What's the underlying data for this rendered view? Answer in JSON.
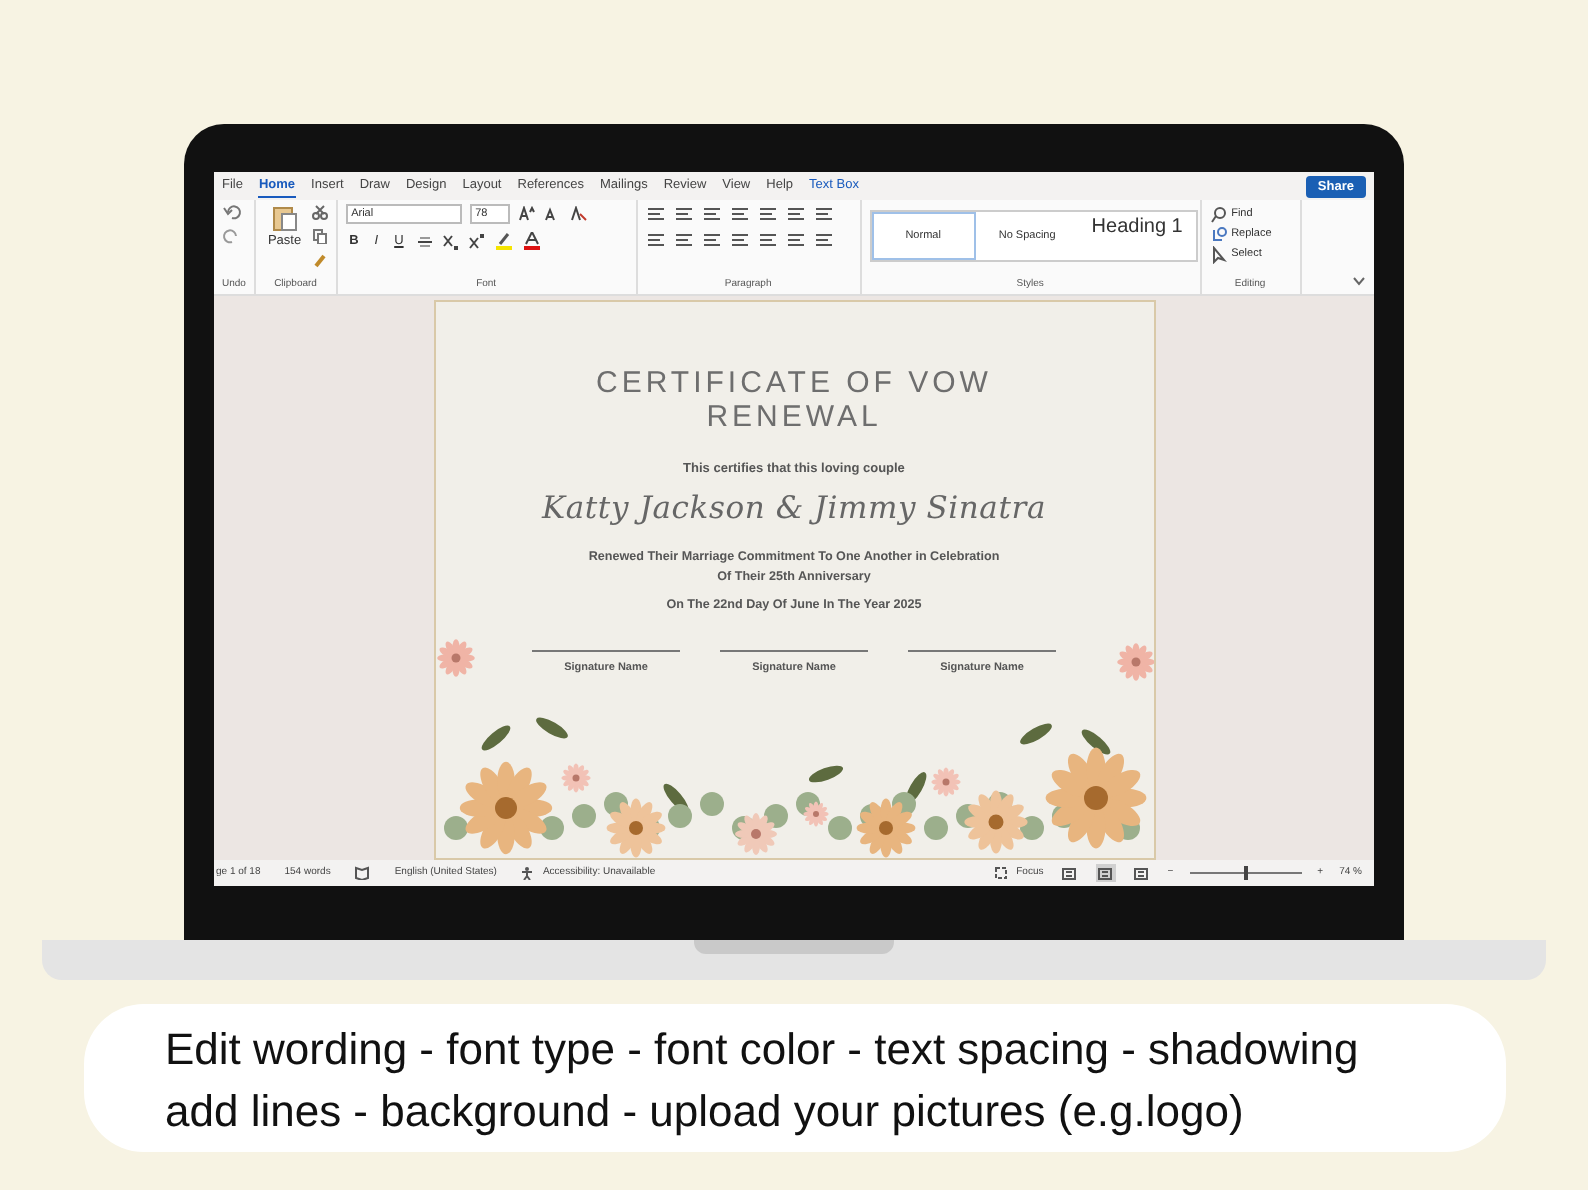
{
  "ribbon_tabs": [
    {
      "label": "File",
      "selected": false
    },
    {
      "label": "Home",
      "selected": true
    },
    {
      "label": "Insert",
      "selected": false
    },
    {
      "label": "Draw",
      "selected": false
    },
    {
      "label": "Design",
      "selected": false
    },
    {
      "label": "Layout",
      "selected": false
    },
    {
      "label": "References",
      "selected": false
    },
    {
      "label": "Mailings",
      "selected": false
    },
    {
      "label": "Review",
      "selected": false
    },
    {
      "label": "View",
      "selected": false
    },
    {
      "label": "Help",
      "selected": false
    },
    {
      "label": "Text Box",
      "selected": false
    }
  ],
  "share_button": "Share",
  "clipboard": {
    "paste": "Paste",
    "label": "Clipboard"
  },
  "undo": {
    "label": "Undo"
  },
  "font": {
    "name": "Arial",
    "size": "78",
    "bold": "B",
    "italic": "I",
    "underline": "U",
    "label": "Font"
  },
  "paragraph": {
    "label": "Paragraph"
  },
  "styles": {
    "items": [
      {
        "label": "Normal",
        "selected": true
      },
      {
        "label": "No Spacing",
        "selected": false
      },
      {
        "label": "Heading 1",
        "selected": false
      }
    ],
    "label": "Styles"
  },
  "editing": {
    "items": [
      "Find",
      "Replace",
      "Select"
    ],
    "label": "Editing"
  },
  "certificate": {
    "title": "CERTIFICATE OF VOW RENEWAL",
    "intro": "This certifies that this loving couple",
    "names": "Katty Jackson  & Jimmy Sinatra",
    "lines": [
      "Renewed Their Marriage Commitment To One Another in Celebration",
      "Of Their 25th Anniversary"
    ],
    "date": "On The 22nd Day Of June In The Year 2025",
    "signatures": [
      "Signature Name",
      "Signature Name",
      "Signature Name"
    ]
  },
  "status_bar": {
    "page": "ge 1 of 18",
    "words": "154 words",
    "language": "English (United States)",
    "accessibility": "Accessibility: Unavailable",
    "focus": "Focus",
    "views": [
      {
        "selected": false
      },
      {
        "selected": true
      },
      {
        "selected": false
      }
    ],
    "zoom_minus": "−",
    "zoom_plus": "+",
    "zoom_level": {
      "level": 0.48
    },
    "zoom": "74 %"
  },
  "caption": [
    "Edit wording - font type - font color - text spacing - shadowing",
    "add lines - background -  upload your pictures (e.g.logo)"
  ]
}
